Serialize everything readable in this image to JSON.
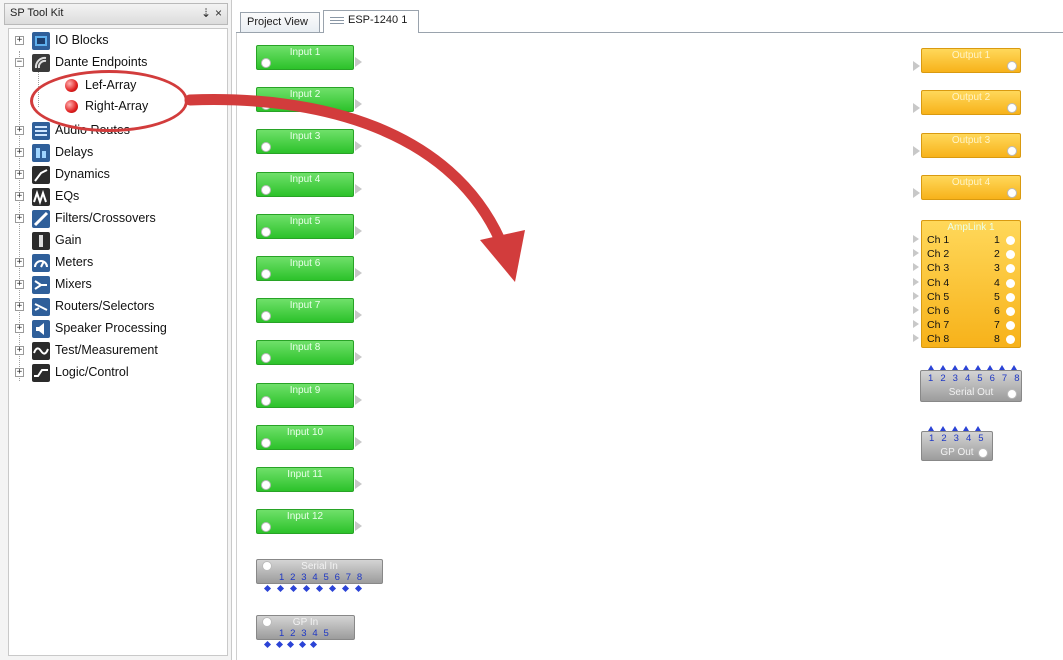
{
  "toolkit": {
    "title": "SP Tool Kit",
    "pin_glyph": "⇣",
    "close_glyph": "×",
    "categories": [
      {
        "label": "IO Blocks",
        "icon": "io-blocks-icon",
        "expander": "+"
      },
      {
        "label": "Dante Endpoints",
        "icon": "dante-endpoints-icon",
        "expander": "−"
      },
      {
        "label": "Audio Routes",
        "icon": "audio-routes-icon",
        "expander": "+"
      },
      {
        "label": "Delays",
        "icon": "delays-icon",
        "expander": "+"
      },
      {
        "label": "Dynamics",
        "icon": "dynamics-icon",
        "expander": "+"
      },
      {
        "label": "EQs",
        "icon": "eqs-icon",
        "expander": "+"
      },
      {
        "label": "Filters/Crossovers",
        "icon": "filters-icon",
        "expander": "+"
      },
      {
        "label": "Gain",
        "icon": "gain-icon",
        "expander": ""
      },
      {
        "label": "Meters",
        "icon": "meters-icon",
        "expander": "+"
      },
      {
        "label": "Mixers",
        "icon": "mixers-icon",
        "expander": "+"
      },
      {
        "label": "Routers/Selectors",
        "icon": "routers-icon",
        "expander": "+"
      },
      {
        "label": "Speaker Processing",
        "icon": "speaker-processing-icon",
        "expander": "+"
      },
      {
        "label": "Test/Measurement",
        "icon": "test-measurement-icon",
        "expander": "+"
      },
      {
        "label": "Logic/Control",
        "icon": "logic-control-icon",
        "expander": "+"
      }
    ],
    "dante_children": [
      {
        "label": "Lef-Array"
      },
      {
        "label": "Right-Array"
      }
    ]
  },
  "tabs": {
    "project_view": "Project View",
    "esp": "ESP-1240 1"
  },
  "inputs": [
    "Input 1",
    "Input 2",
    "Input 3",
    "Input 4",
    "Input 5",
    "Input 6",
    "Input 7",
    "Input 8",
    "Input 9",
    "Input 10",
    "Input 11",
    "Input 12"
  ],
  "outputs": [
    "Output 1",
    "Output 2",
    "Output 3",
    "Output 4"
  ],
  "amplink": {
    "title": "AmpLink 1",
    "channels": [
      {
        "label": "Ch 1",
        "num": "1"
      },
      {
        "label": "Ch 2",
        "num": "2"
      },
      {
        "label": "Ch 3",
        "num": "3"
      },
      {
        "label": "Ch 4",
        "num": "4"
      },
      {
        "label": "Ch 5",
        "num": "5"
      },
      {
        "label": "Ch 6",
        "num": "6"
      },
      {
        "label": "Ch 7",
        "num": "7"
      },
      {
        "label": "Ch 8",
        "num": "8"
      }
    ]
  },
  "serial_in": {
    "title": "Serial In",
    "pins": "1 2 3 4 5 6 7 8"
  },
  "gp_in": {
    "title": "GP In",
    "pins": "1 2 3 4 5"
  },
  "serial_out": {
    "title": "Serial Out",
    "pins": "1 2 3 4 5 6 7 8"
  },
  "gp_out": {
    "title": "GP Out",
    "pins": "1 2 3 4 5"
  },
  "colors": {
    "input_block": "#2cc22a",
    "output_block": "#f7b21a",
    "annotation": "#d23c3c",
    "pin_blue": "#2b43d6"
  }
}
